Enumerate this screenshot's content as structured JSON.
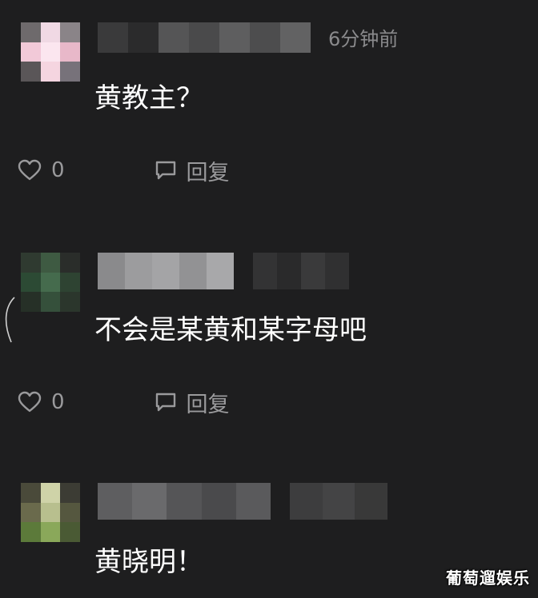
{
  "comments": [
    {
      "timestamp": "6分钟前",
      "text": "黄教主？",
      "like_count": "0",
      "reply_label": "回复"
    },
    {
      "timestamp": "",
      "text": "不会是某黄和某字母吧",
      "like_count": "0",
      "reply_label": "回复"
    },
    {
      "timestamp": "",
      "text": "黄晓明！"
    }
  ],
  "icons": {
    "like": "heart-outline-icon",
    "reply": "speech-bubble-icon"
  },
  "colors": {
    "background": "#1e1e1f",
    "text": "#ffffff",
    "muted": "#9a9a9c"
  },
  "watermark": "葡萄遛娱乐"
}
